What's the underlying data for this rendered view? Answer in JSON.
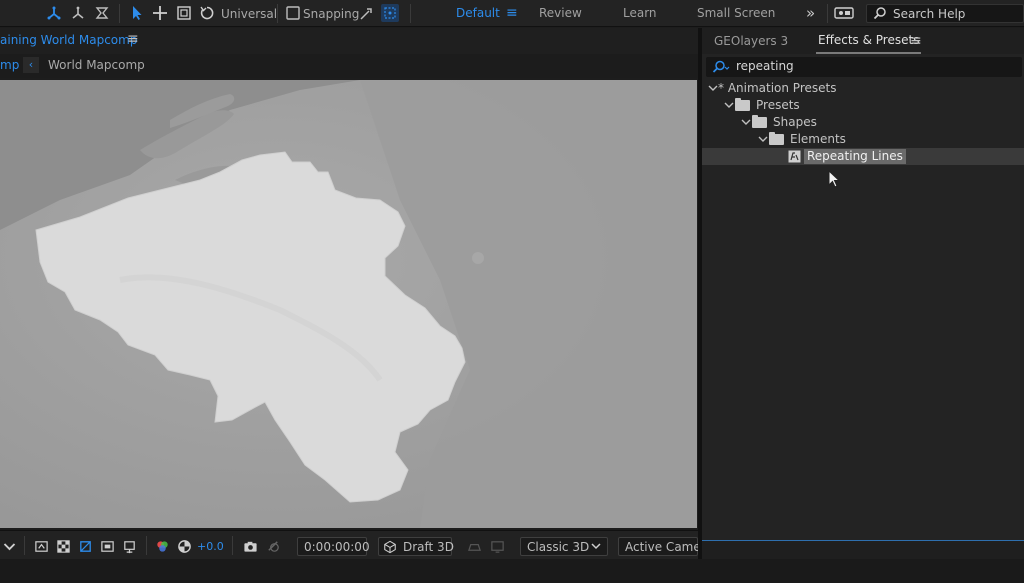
{
  "toolbar": {
    "universal_label": "Universal",
    "snapping_label": "Snapping",
    "workspaces": [
      {
        "label": "Default",
        "active": true
      },
      {
        "label": "Review",
        "active": false
      },
      {
        "label": "Learn",
        "active": false
      },
      {
        "label": "Small Screen",
        "active": false
      }
    ],
    "overflow_label": "»",
    "search_placeholder": "Search Help"
  },
  "comp": {
    "title": "aining World Mapcomp",
    "tab_short": "mp",
    "breadcrumb": "World Mapcomp",
    "map_region": "Belgium",
    "footer": {
      "exposure": "+0.0",
      "timecode": "0:00:00:00",
      "renderer": "Draft 3D",
      "renderer_mode": "Classic 3D",
      "view": "Active Camer..."
    }
  },
  "effects_panel": {
    "tabs": [
      {
        "label": "GEOlayers 3",
        "active": false
      },
      {
        "label": "Effects & Presets",
        "active": true
      }
    ],
    "search_value": "repeating",
    "tree": [
      {
        "label": "* Animation Presets",
        "depth": 0,
        "type": "root"
      },
      {
        "label": "Presets",
        "depth": 1,
        "type": "folder"
      },
      {
        "label": "Shapes",
        "depth": 2,
        "type": "folder"
      },
      {
        "label": "Elements",
        "depth": 3,
        "type": "folder"
      },
      {
        "label": "Repeating Lines",
        "depth": 4,
        "type": "preset",
        "selected": true
      }
    ]
  },
  "colors": {
    "accent": "#2d8ceb",
    "panel_bg": "#232323",
    "map_land": "#d9d9d9",
    "map_water": "#8d8d8d"
  }
}
